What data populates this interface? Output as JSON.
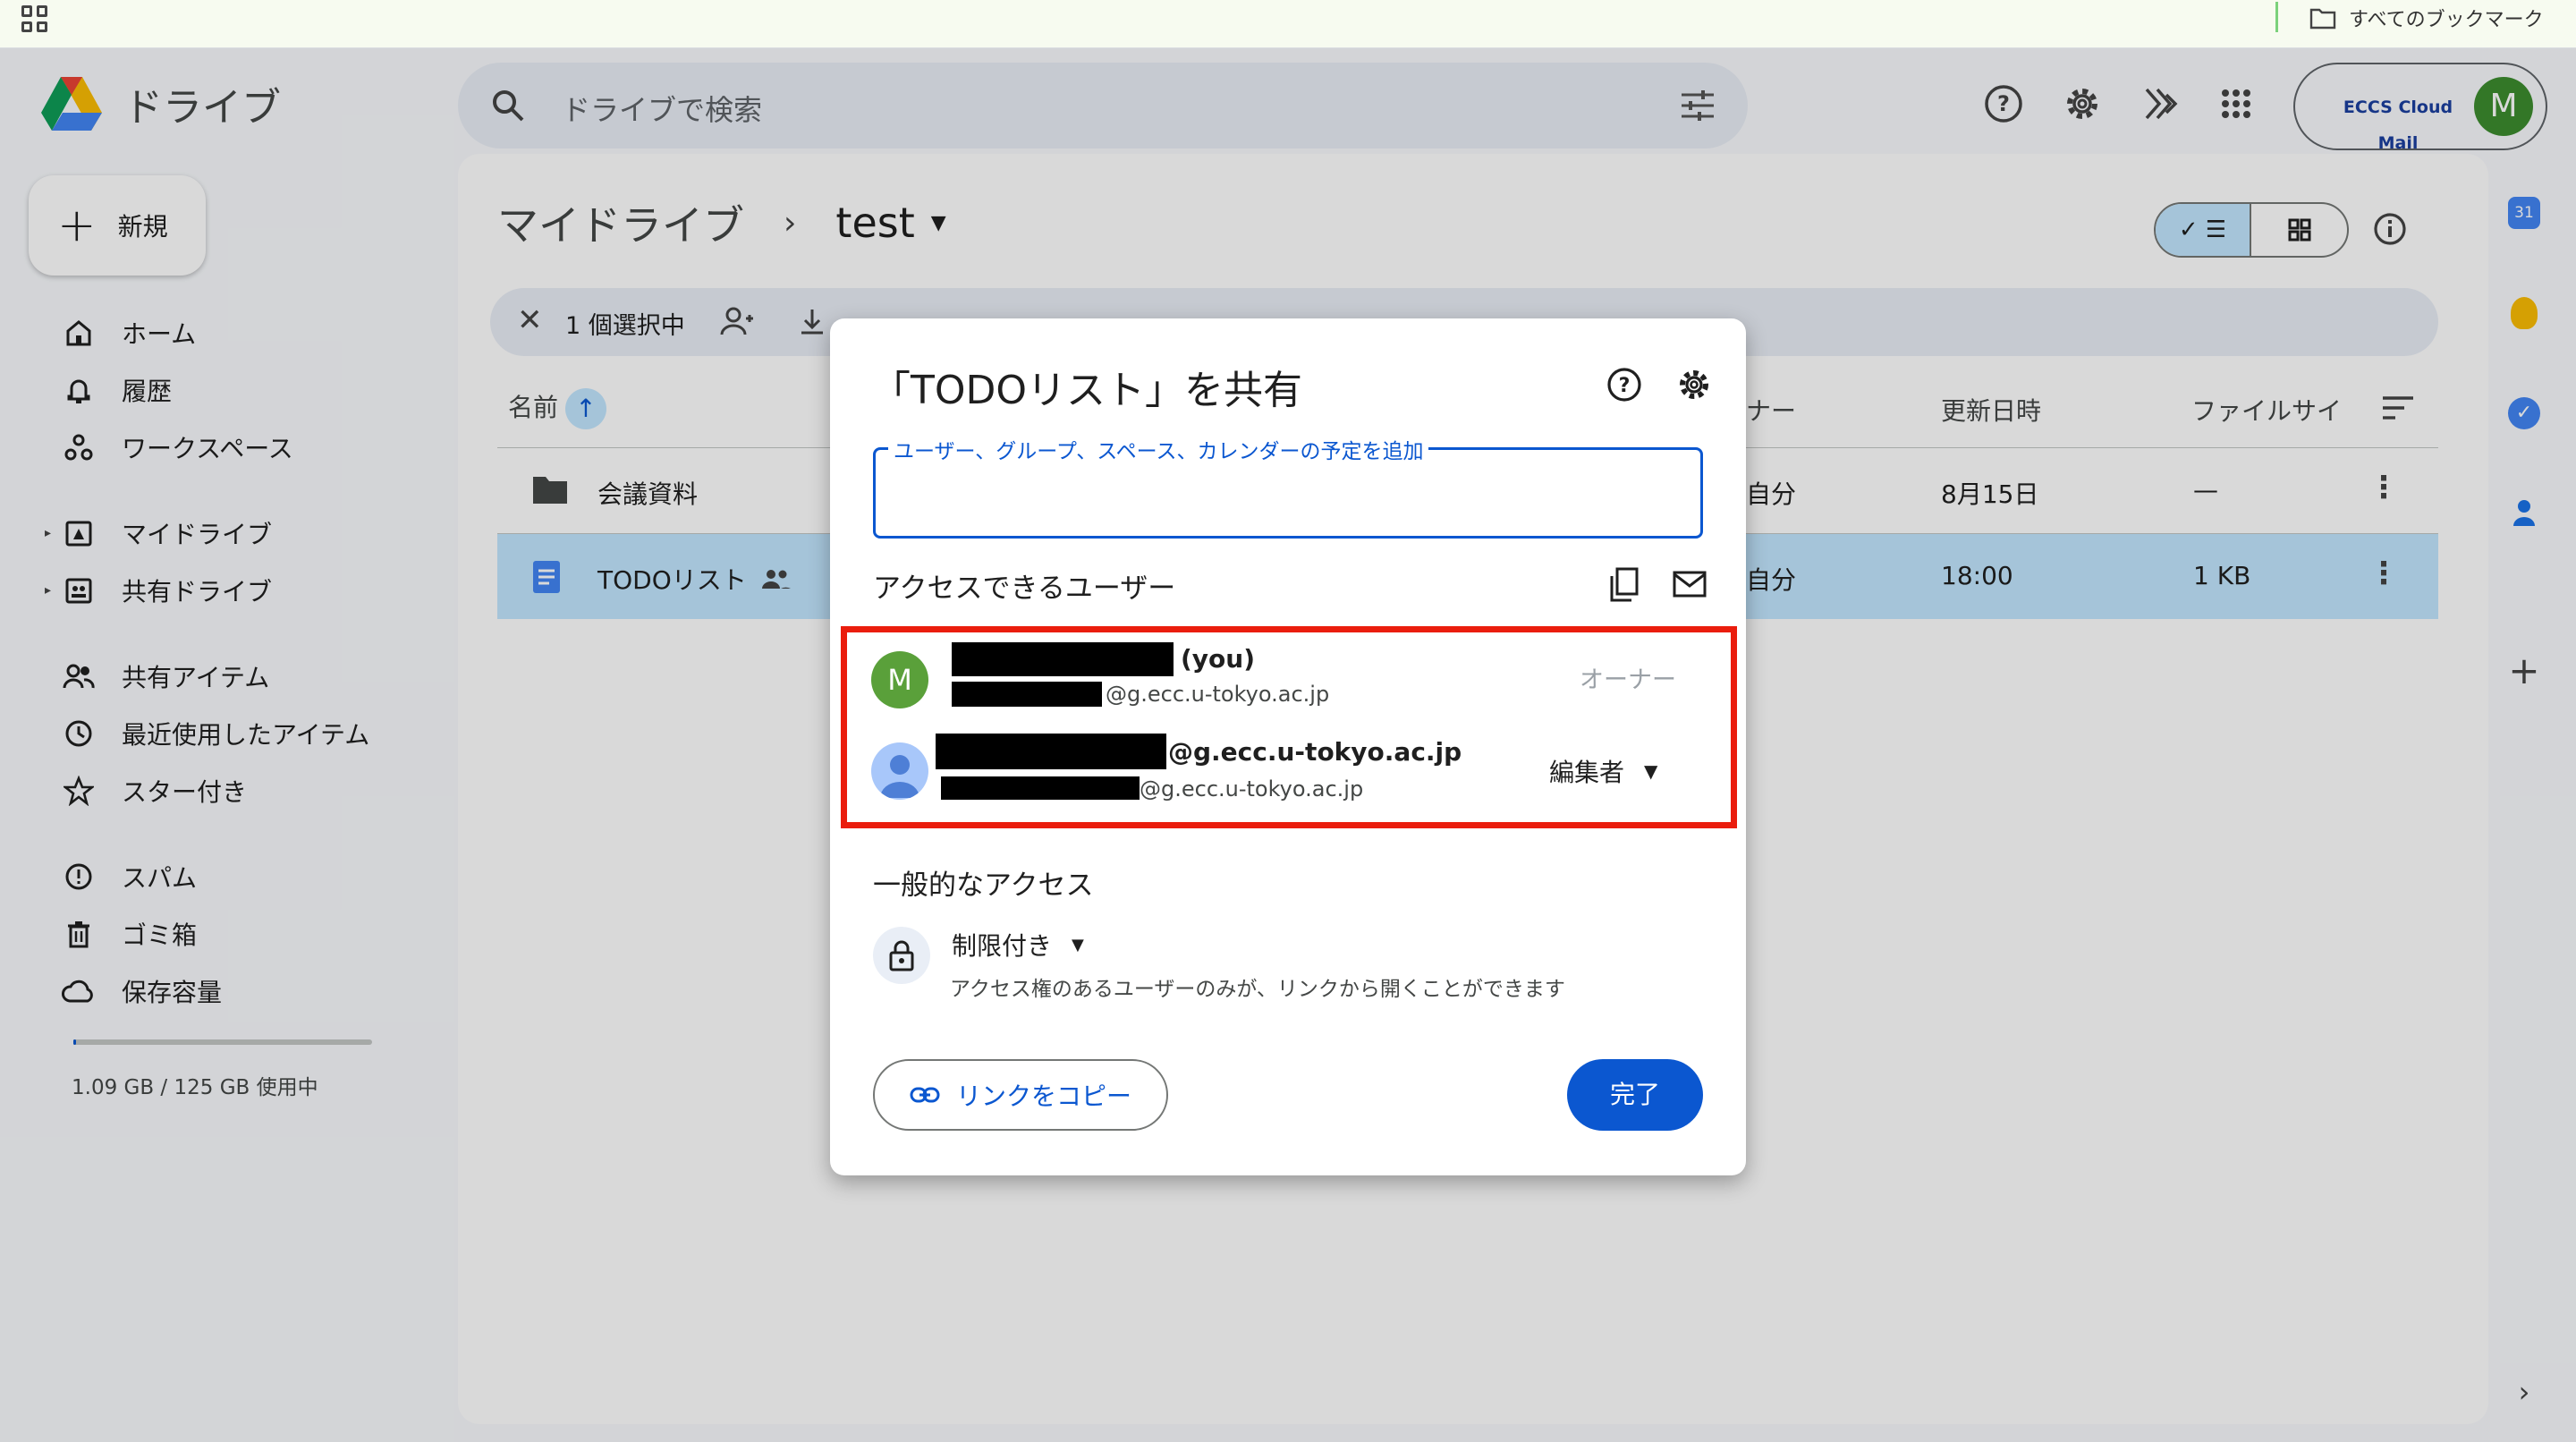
{
  "bookmarks": {
    "all_bookmarks_label": "すべてのブックマーク"
  },
  "header": {
    "app_name": "ドライブ",
    "search_placeholder": "ドライブで検索",
    "account_logo_text": "ECCS Cloud Mail",
    "avatar_letter": "M"
  },
  "sidebar": {
    "new_label": "新規",
    "items": [
      {
        "label": "ホーム",
        "icon": "home-icon"
      },
      {
        "label": "履歴",
        "icon": "bell-icon"
      },
      {
        "label": "ワークスペース",
        "icon": "workspaces-icon"
      },
      {
        "label": "マイドライブ",
        "icon": "my-drive-icon"
      },
      {
        "label": "共有ドライブ",
        "icon": "shared-drive-icon"
      },
      {
        "label": "共有アイテム",
        "icon": "people-icon"
      },
      {
        "label": "最近使用したアイテム",
        "icon": "clock-icon"
      },
      {
        "label": "スター付き",
        "icon": "star-icon"
      },
      {
        "label": "スパム",
        "icon": "spam-icon"
      },
      {
        "label": "ゴミ箱",
        "icon": "trash-icon"
      },
      {
        "label": "保存容量",
        "icon": "cloud-icon"
      }
    ],
    "storage_text": "1.09 GB / 125 GB 使用中",
    "storage_fraction": 0.0087
  },
  "main": {
    "breadcrumb_root": "マイドライブ",
    "breadcrumb_current": "test",
    "selection_count": "1 個選択中",
    "columns": {
      "name": "名前",
      "owner": "ナー",
      "modified": "更新日時",
      "size": "ファイルサイ"
    },
    "rows": [
      {
        "name": "会議資料",
        "owner": "自分",
        "modified": "8月15日",
        "size": "—",
        "type": "folder"
      },
      {
        "name": "TODOリスト",
        "owner": "自分",
        "modified": "18:00",
        "size": "1 KB",
        "type": "doc",
        "selected": true
      }
    ]
  },
  "right_rail": {
    "calendar_day": "31"
  },
  "dialog": {
    "title": "「TODOリスト」を共有",
    "add_label": "ユーザー、グループ、スペース、カレンダーの予定を追加",
    "access_heading": "アクセスできるユーザー",
    "users": [
      {
        "avatar_letter": "M",
        "you_suffix": "(you)",
        "email_suffix": "@g.ecc.u-tokyo.ac.jp",
        "role": "オーナー"
      },
      {
        "primary_suffix": "@g.ecc.u-tokyo.ac.jp",
        "email_suffix": "@g.ecc.u-tokyo.ac.jp",
        "role": "編集者"
      }
    ],
    "general_heading": "一般的なアクセス",
    "restriction": "制限付き",
    "restriction_desc": "アクセス権のあるユーザーのみが、リンクから開くことができます",
    "copy_link": "リンクをコピー",
    "done": "完了"
  },
  "colors": {
    "accent": "#0b57d0",
    "selected": "#c2e7ff",
    "highlight": "#ea1d0d"
  }
}
